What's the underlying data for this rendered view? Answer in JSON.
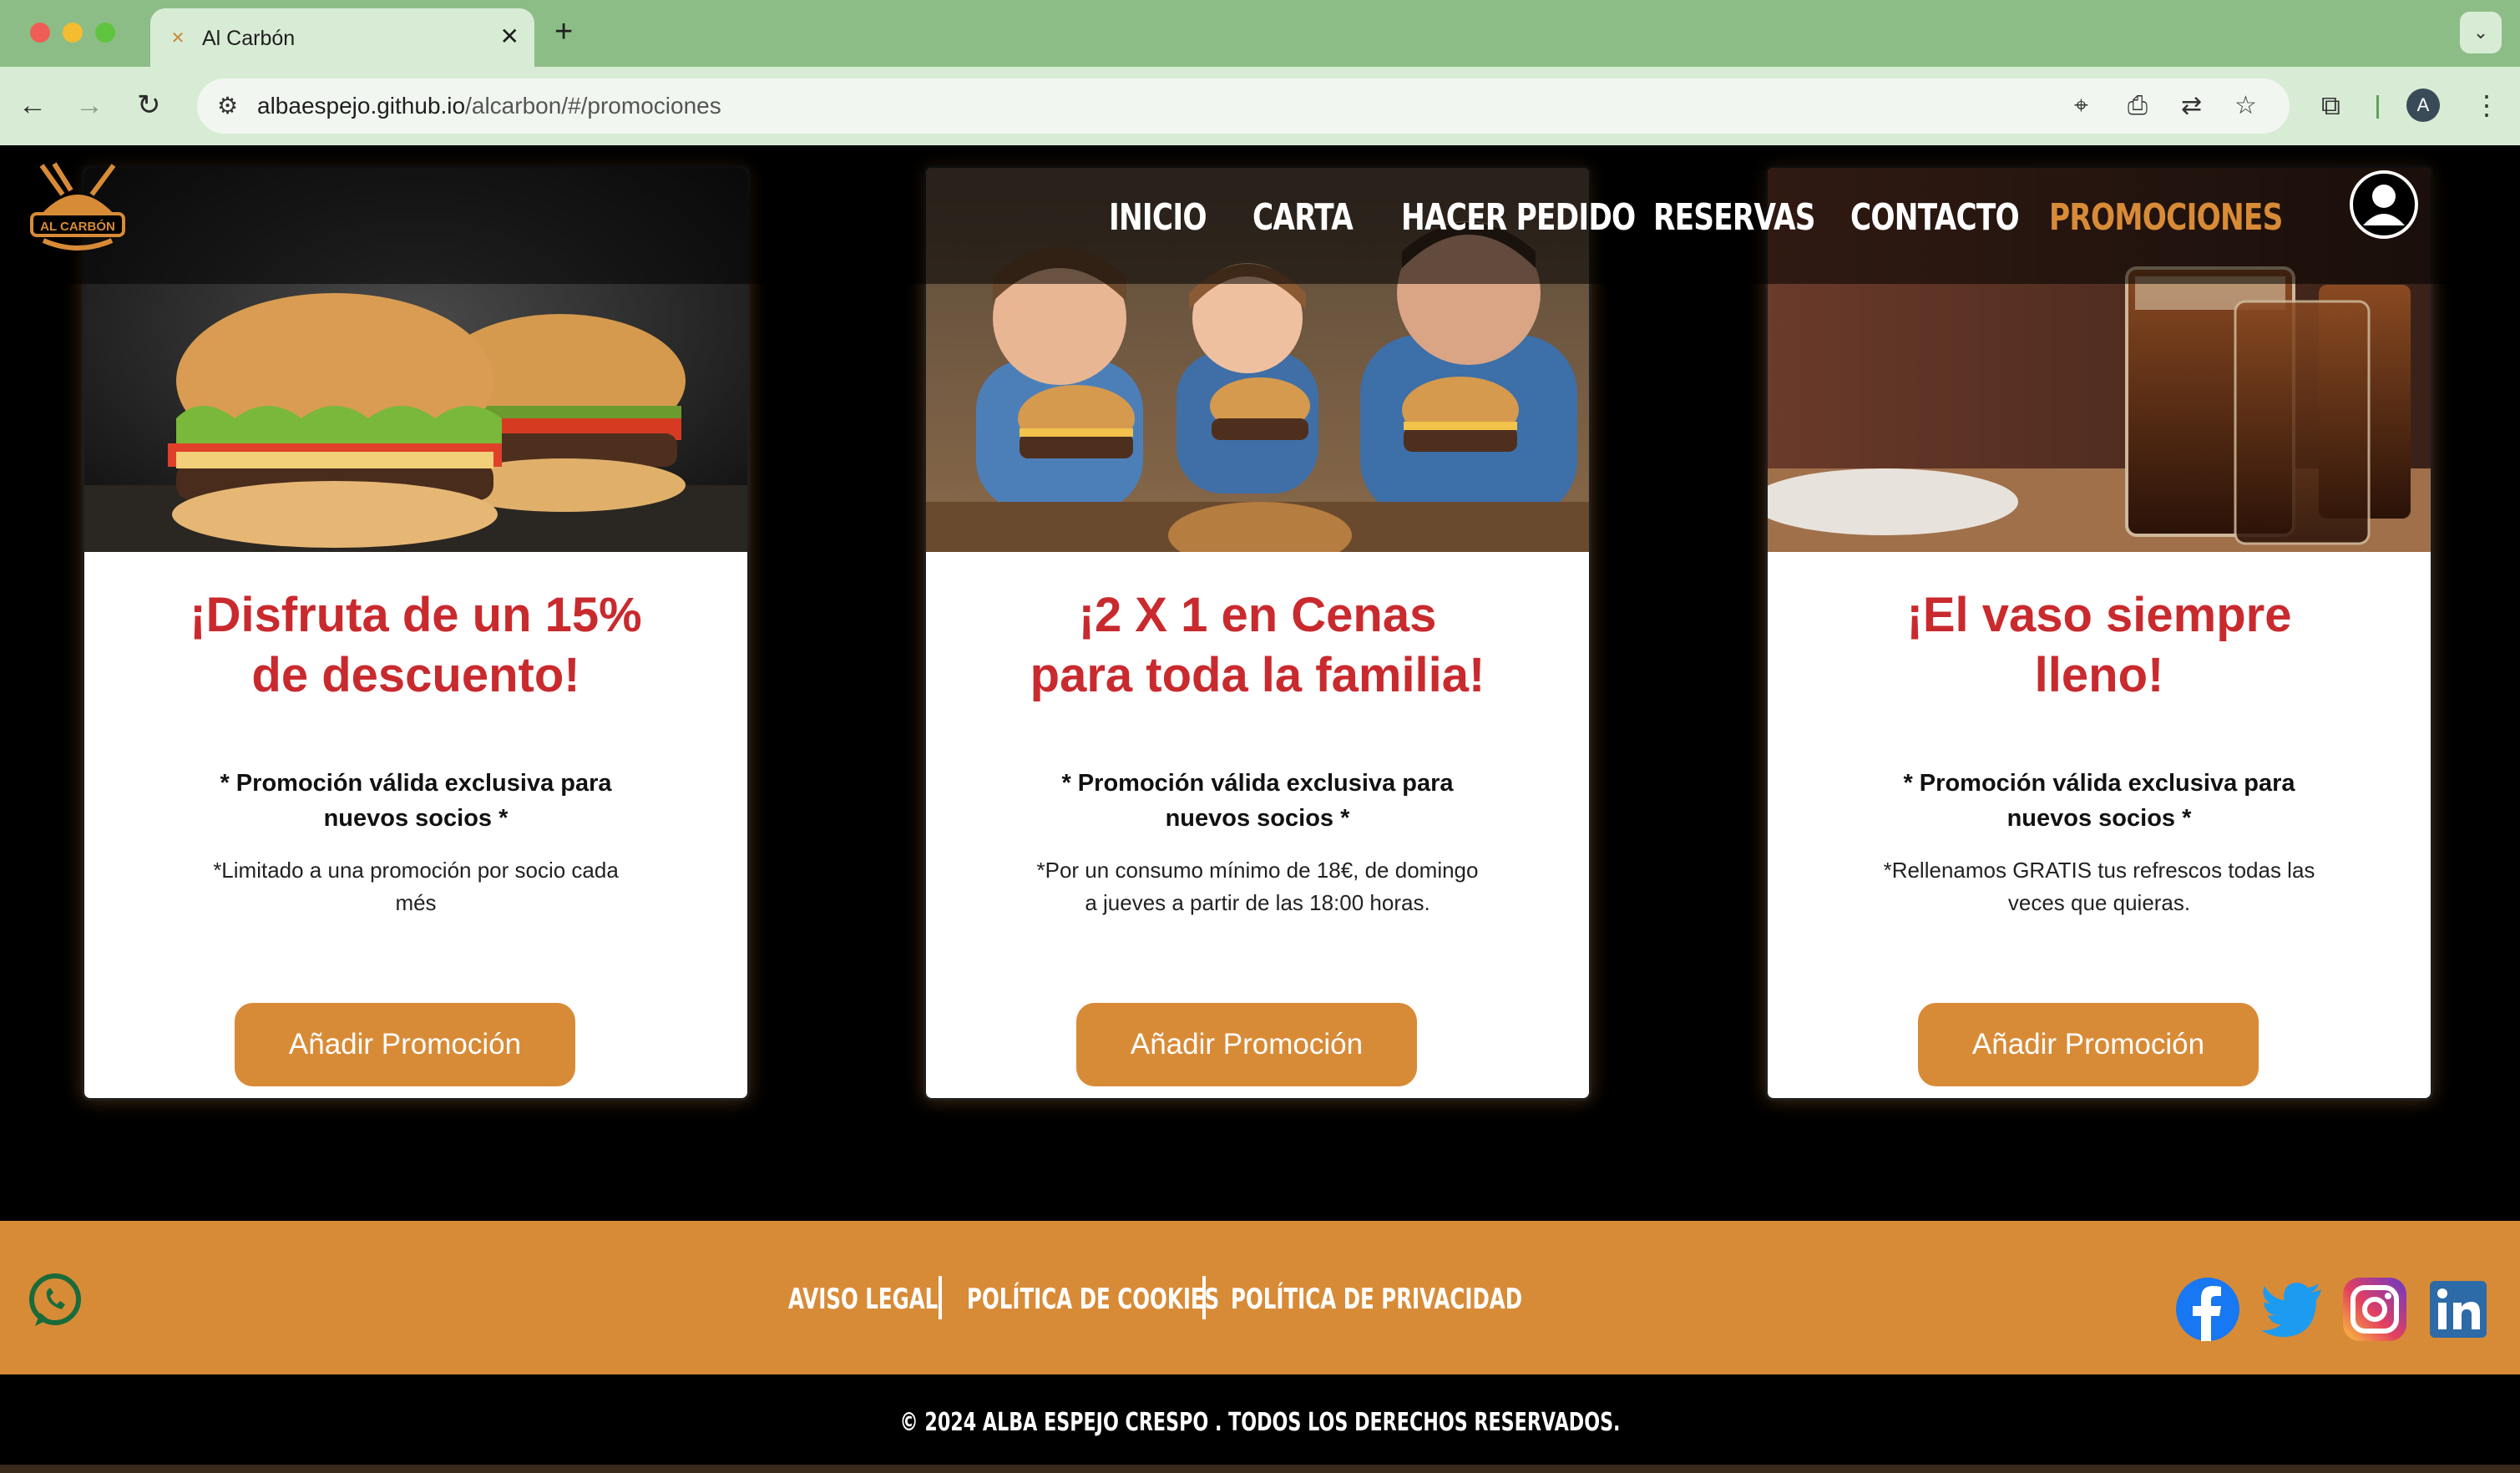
{
  "browser": {
    "tab_title": "Al Carbón",
    "url_domain": "albaespejo.github.io",
    "url_path": "/alcarbon/#/promociones",
    "profile_initial": "A"
  },
  "header": {
    "logo_text": "AL CARBÓN",
    "nav": [
      "INICIO",
      "CARTA",
      "HACER PEDIDO",
      "RESERVAS",
      "CONTACTO",
      "PROMOCIONES"
    ],
    "active_index": 5
  },
  "promotions": [
    {
      "title_line1": "¡Disfruta de un 15%",
      "title_line2": "de descuento!",
      "strong_line1": "* Promoción válida exclusiva para",
      "strong_line2": "nuevos socios *",
      "note_line1": "*Limitado a una promoción por socio cada",
      "note_line2": "més",
      "button": "Añadir Promoción",
      "image": "burgers"
    },
    {
      "title_line1": "¡2 X 1 en Cenas",
      "title_line2": "para toda la familia!",
      "strong_line1": "* Promoción válida exclusiva para",
      "strong_line2": "nuevos socios *",
      "note_line1": "*Por un consumo mínimo de 18€, de domingo",
      "note_line2": "a jueves a partir de las 18:00 horas.",
      "button": "Añadir Promoción",
      "image": "family-eating"
    },
    {
      "title_line1": "¡El vaso siempre",
      "title_line2": "lleno!",
      "strong_line1": "* Promoción válida exclusiva para",
      "strong_line2": "nuevos socios *",
      "note_line1": "*Rellenamos GRATIS tus refrescos todas las",
      "note_line2": "veces que quieras.",
      "button": "Añadir Promoción",
      "image": "soda-glasses"
    }
  ],
  "footer": {
    "links": [
      "AVISO LEGAL",
      "POLÍTICA DE COOKIES",
      "POLÍTICA DE PRIVACIDAD"
    ],
    "copyright": "© 2024 ALBA ESPEJO CRESPO . TODOS LOS DERECHOS RESERVADOS."
  },
  "colors": {
    "accent": "#d88b37",
    "title_red": "#c92a2e",
    "tab_green": "#8dbd86"
  }
}
